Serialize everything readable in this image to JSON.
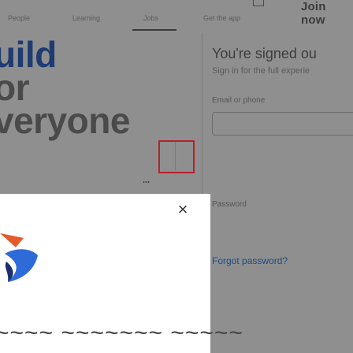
{
  "nav": {
    "items": [
      "People",
      "Learning",
      "Jobs",
      "Get the app"
    ],
    "join_label": "Join now"
  },
  "hero": {
    "line1": "uild",
    "line2": "or",
    "line3": "veryone",
    "dots": "..."
  },
  "signin": {
    "title": "You're signed ou",
    "subtitle": "Sign in for the full experie",
    "email_label": "Email or phone",
    "password_label": "Password",
    "forgot_label": "Forgot password?"
  },
  "card": {
    "close_icon": "×",
    "text": "~~~~ ~~~~~~~ ~~~~~"
  },
  "colors": {
    "overlay_dim": "#8f8f8f",
    "focus_border": "#b3222b",
    "hero_accent": "#1f3b73",
    "link": "#1d4a87"
  }
}
